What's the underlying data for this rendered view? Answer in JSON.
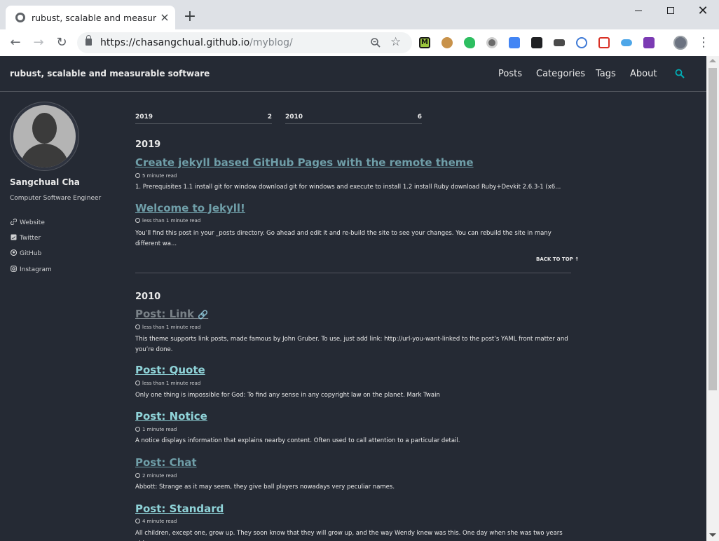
{
  "browser": {
    "tab_title": "rubust, scalable and measurable",
    "url_host": "https://chasangchual.github.io",
    "url_path": "/myblog/",
    "new_tab": "+",
    "close_tab": "×",
    "close_window": "✕",
    "back": "←",
    "forward": "→",
    "reload": "↻",
    "star": "☆",
    "menu": "⋮",
    "extensions": [
      "M",
      "cookie-icon",
      "evernote-icon",
      "circle-icon",
      "calendar-icon",
      "tab-icon",
      "camera-icon",
      "compass-icon",
      "pdf-icon",
      "cloud-icon",
      "onenote-icon"
    ]
  },
  "masthead": {
    "site_title": "rubust, scalable and measurable software",
    "nav": [
      "Posts",
      "Categories",
      "Tags",
      "About"
    ]
  },
  "author": {
    "name": "Sangchual Cha",
    "bio": "Computer Software Engineer",
    "links": [
      "Website",
      "Twitter",
      "GitHub",
      "Instagram"
    ]
  },
  "year_nav": [
    {
      "year": "2019",
      "count": "2"
    },
    {
      "year": "2010",
      "count": "6"
    }
  ],
  "years": [
    {
      "year": "2019",
      "posts": [
        {
          "title": "Create jekyll based GitHub Pages with the remote theme",
          "meta": "5 minute read",
          "excerpt": "1. Prerequisites 1.1 install git for window download git for windows and execute to install 1.2 install Ruby download Ruby+Devkit 2.6.3-1 (x6..."
        },
        {
          "title": "Welcome to Jekyll!",
          "meta": "less than 1 minute read",
          "excerpt": "You’ll find this post in your _posts directory. Go ahead and edit it and re-build the site to see your changes. You can rebuild the site in many different wa..."
        }
      ]
    },
    {
      "year": "2010",
      "posts": [
        {
          "title": "Post: Link",
          "link_glyph": "🔗",
          "meta": "less than 1 minute read",
          "excerpt": "This theme supports link posts, made famous by John Gruber. To use, just add link: http://url-you-want-linked to the post’s YAML front matter and you’re done."
        },
        {
          "title": "Post: Quote",
          "meta": "less than 1 minute read",
          "excerpt": "Only one thing is impossible for God: To find any sense in any copyright law on the planet. Mark Twain"
        },
        {
          "title": "Post: Notice",
          "meta": "1 minute read",
          "excerpt": "A notice displays information that explains nearby content. Often used to call attention to a particular detail."
        },
        {
          "title": "Post: Chat",
          "meta": "2 minute read",
          "excerpt": "Abbott: Strange as it may seem, they give ball players nowadays very peculiar names."
        },
        {
          "title": "Post: Standard",
          "meta": "4 minute read",
          "excerpt": "All children, except one, grow up. They soon know that they will grow up, and the way Wendy knew was this. One day when she was two years old"
        }
      ]
    }
  ],
  "back_to_top": "BACK TO TOP ↑",
  "colors": {
    "page_bg": "#252a34",
    "link": "#8fd3d8",
    "accent_search": "#00adb5",
    "text": "#eaeaea"
  }
}
